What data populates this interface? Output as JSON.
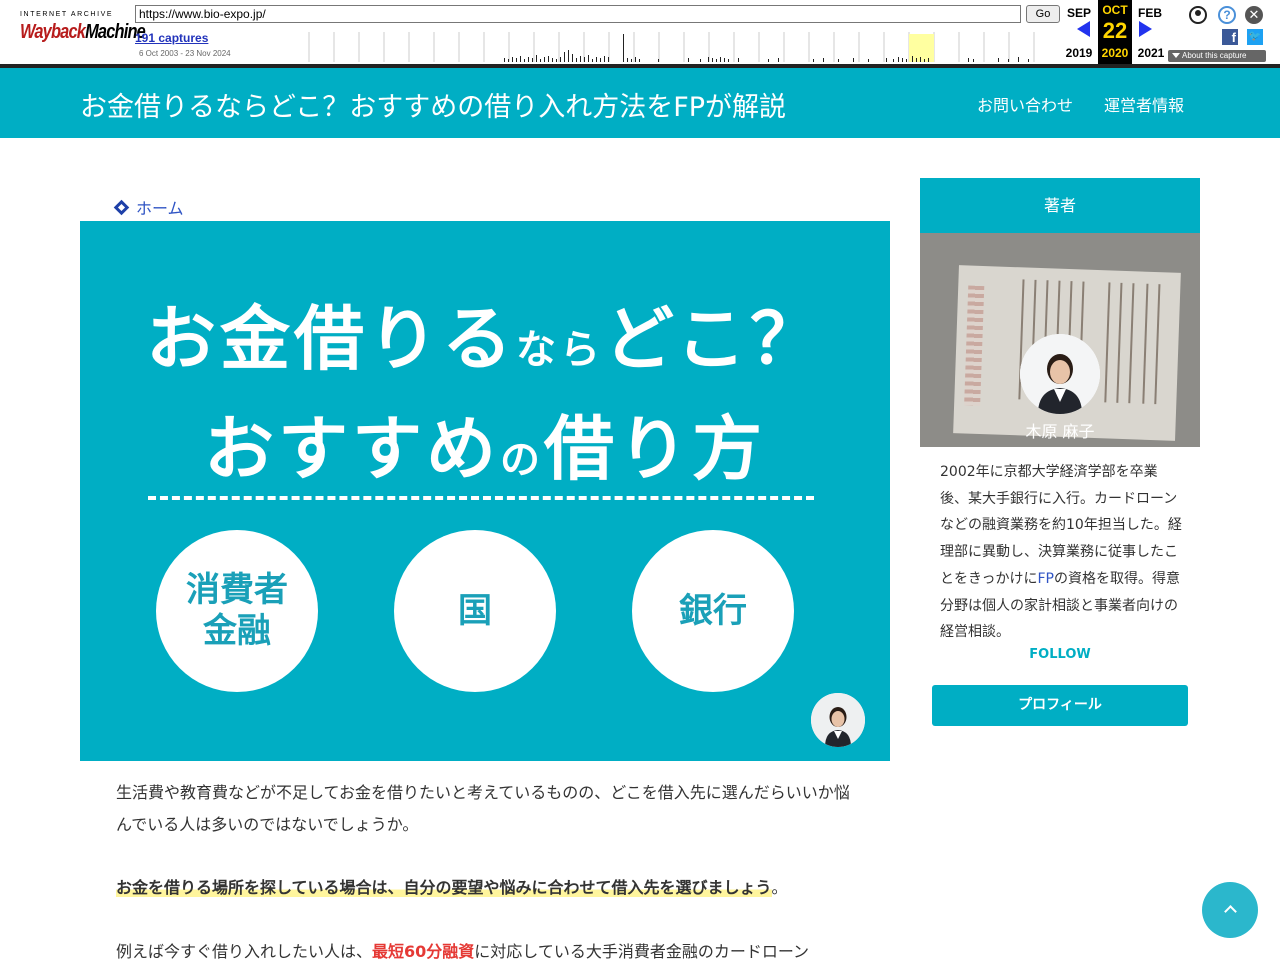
{
  "wayback": {
    "logo_top": "INTERNET ARCHIVE",
    "logo_main_a": "Wayback",
    "logo_main_b": "Machine",
    "url": "https://www.bio-expo.jp/",
    "go_label": "Go",
    "captures": "191 captures",
    "range": "6 Oct 2003 - 23 Nov 2024",
    "prev_month": "SEP",
    "prev_year": "2019",
    "cur_month": "OCT",
    "cur_day": "22",
    "cur_year": "2020",
    "next_month": "FEB",
    "next_year": "2021",
    "about": "About this capture",
    "help_glyph": "?",
    "close_glyph": "✕",
    "fb_glyph": "f",
    "tw_glyph": "🐦"
  },
  "site": {
    "title": "お金借りるならどこ？おすすめの借り入れ方法をFPが解説",
    "nav": {
      "contact": "お問い合わせ",
      "operator": "運営者情報"
    }
  },
  "breadcrumb": {
    "home": "ホーム"
  },
  "hero": {
    "line1_a": "お金借りる",
    "line1_small": "なら",
    "line1_b": "どこ？",
    "line2_a": "おすすめ",
    "line2_small": "の",
    "line2_b": "借り方",
    "circle_1": "消費者\n金融",
    "circle_2": "国",
    "circle_3": "銀行"
  },
  "article": {
    "p1": "生活費や教育費などが不足してお金を借りたいと考えているものの、どこを借入先に選んだらいいか悩んでいる人は多いのではないでしょうか。",
    "p2_mark": "お金を借りる場所を探している場合は、自分の要望や悩みに合わせて借入先を選びましょう",
    "p2_end": "。",
    "p3_a": "例えば今すぐ借り入れしたい人は、",
    "p3_red": "最短60分融資",
    "p3_b": "に対応している大手消費者金融のカードローン"
  },
  "sidebar": {
    "heading": "著者",
    "name": "木原 麻子",
    "bio_a": "2002年に京都大学経済学部を卒業後、某大手銀行に入行。カードローンなどの融資業務を約10年担当した。経理部に異動し、決算業務に従事したことをきっかけに",
    "bio_fp": "FP",
    "bio_b": "の資格を取得。得意分野は個人の家計相談と事業者向けの経営相談。",
    "follow": "FOLLOW",
    "profile_button": "プロフィール"
  },
  "colors": {
    "brand": "#00aec4",
    "highlight": "#fff59d",
    "accent_red": "#e53935",
    "link": "#2f54c4"
  }
}
